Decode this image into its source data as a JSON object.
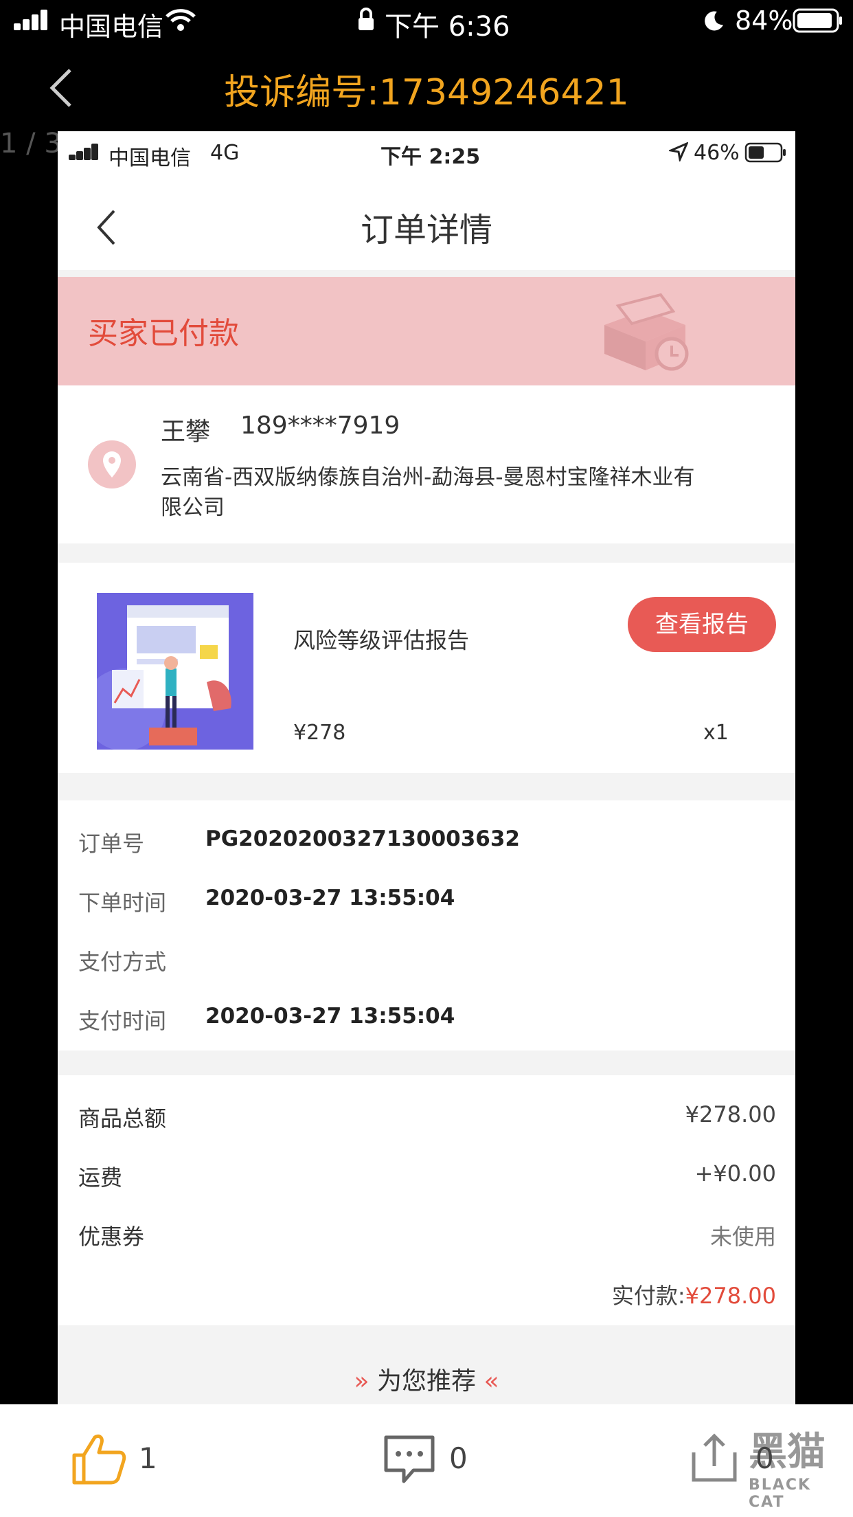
{
  "outer_status": {
    "carrier": "中国电信",
    "time": "下午 6:36",
    "battery": "84%"
  },
  "header": {
    "title": "投诉编号:17349246421",
    "page_counter": "1 / 3"
  },
  "inner_status": {
    "carrier": "中国电信",
    "network": "4G",
    "time": "下午 2:25",
    "battery": "46%"
  },
  "inner_nav": {
    "title": "订单详情"
  },
  "order_status": {
    "text": "买家已付款"
  },
  "address": {
    "name": "王攀",
    "phone": "189****7919",
    "line1": "云南省-西双版纳傣族自治州-勐海县-曼恩村宝隆祥木业有",
    "line2": "限公司"
  },
  "product": {
    "name": "风险等级评估报告",
    "button": "查看报告",
    "price": "¥278",
    "quantity": "x1"
  },
  "order_info": {
    "order_no_label": "订单号",
    "order_no": "PG202020032713000363​2",
    "order_time_label": "下单时间",
    "order_time": "2020-03-27 13:55:04",
    "pay_method_label": "支付方式",
    "pay_method": "",
    "pay_time_label": "支付时间",
    "pay_time": "2020-03-27 13:55:04"
  },
  "amounts": {
    "subtotal_label": "商品总额",
    "subtotal": "¥278.00",
    "shipping_label": "运费",
    "shipping": "+¥0.00",
    "coupon_label": "优惠券",
    "coupon": "未使用",
    "paid_label": "实付款:",
    "paid": "¥278.00"
  },
  "recommend": {
    "text": "为您推荐"
  },
  "bottom_bar": {
    "likes": "1",
    "comments": "0",
    "third_count": "0",
    "watermark_brand": "黑猫",
    "watermark_sub": "BLACK CAT"
  },
  "colors": {
    "accent_orange": "#f2a51f",
    "status_red": "#e24b3b",
    "banner_pink": "#f2c3c5",
    "button_red": "#e85a55"
  }
}
